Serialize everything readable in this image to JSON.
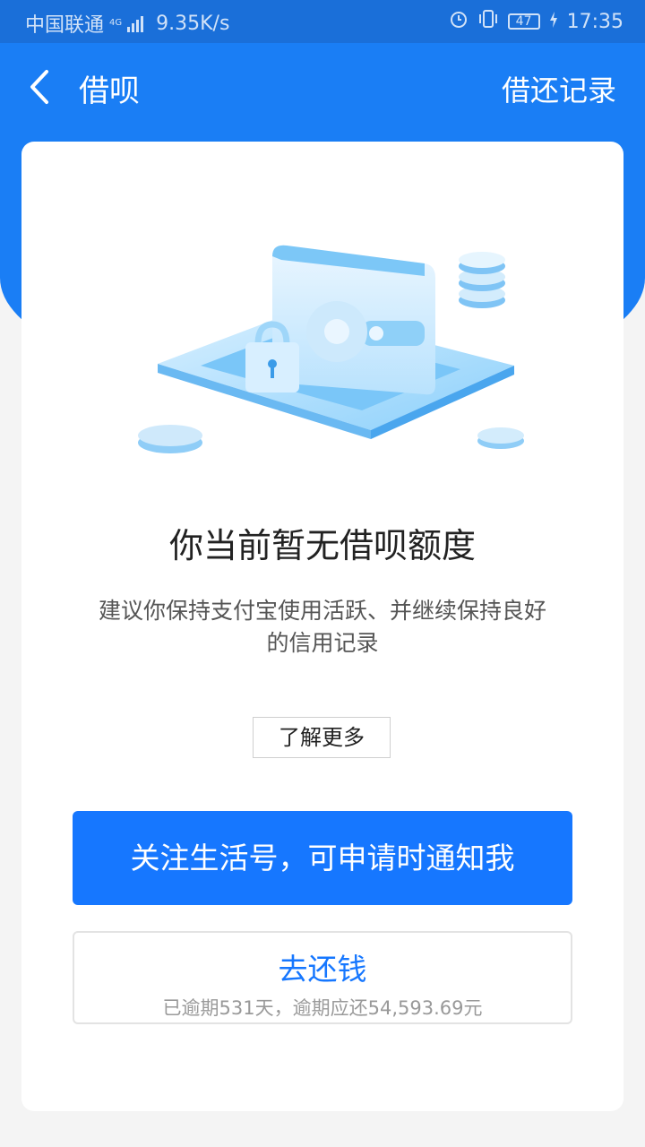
{
  "status_bar": {
    "carrier": "中国联通",
    "network": "4G",
    "speed": "9.35K/s",
    "battery": "47",
    "time": "17:35",
    "icons": [
      "alarm-icon",
      "vibrate-icon",
      "battery-icon",
      "charging-icon"
    ]
  },
  "nav": {
    "title": "借呗",
    "right_link": "借还记录",
    "back_icon": "chevron-left-icon"
  },
  "main": {
    "headline": "你当前暂无借呗额度",
    "description": "建议你保持支付宝使用活跃、并继续保持良好的信用记录",
    "learn_more": "了解更多",
    "primary_button": "关注生活号，可申请时通知我",
    "repay_button": {
      "title": "去还钱",
      "subtitle": "已逾期531天，逾期应还54,593.69元"
    }
  },
  "colors": {
    "brand": "#1a7ef5",
    "primary_button": "#1677ff",
    "page_bg": "#f4f4f4"
  }
}
